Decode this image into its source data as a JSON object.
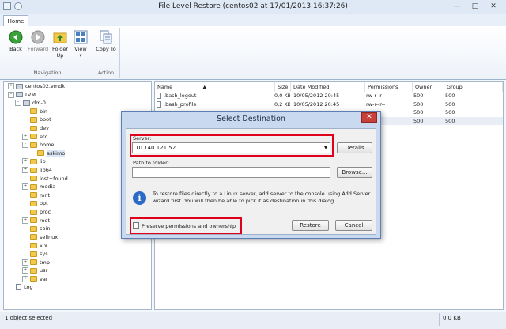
{
  "window": {
    "title": "File Level Restore (centos02 at 17/01/2013 16:37:26)",
    "controls": {
      "minimize": "—",
      "maximize": "□",
      "close": "✕"
    }
  },
  "ribbon": {
    "tabs": [
      {
        "label": "Home",
        "active": true
      }
    ],
    "buttons": [
      {
        "label": "Back",
        "icon": "back-arrow-icon"
      },
      {
        "label": "Forward",
        "icon": "forward-arrow-icon"
      },
      {
        "label": "Folder Up",
        "icon": "folder-up-icon"
      },
      {
        "label": "View",
        "icon": "view-grid-icon"
      },
      {
        "label": "Copy To",
        "icon": "copy-to-icon"
      }
    ],
    "groups": [
      {
        "label": "Navigation"
      },
      {
        "label": "Action"
      }
    ]
  },
  "tree": {
    "nodes": [
      {
        "label": "centos02.vmdk",
        "icon": "disk-icon",
        "expander": "+"
      },
      {
        "label": "LVM",
        "icon": "disk-icon",
        "expander": "-"
      },
      {
        "label": "dm-0",
        "icon": "disk-icon",
        "expander": "-"
      },
      {
        "label": "bin",
        "icon": "folder-icon",
        "expander": ""
      },
      {
        "label": "boot",
        "icon": "folder-icon",
        "expander": ""
      },
      {
        "label": "dev",
        "icon": "folder-icon",
        "expander": ""
      },
      {
        "label": "etc",
        "icon": "folder-icon",
        "expander": "+"
      },
      {
        "label": "home",
        "icon": "folder-icon",
        "expander": "-"
      },
      {
        "label": "askimo",
        "icon": "folder-icon",
        "expander": ""
      },
      {
        "label": "lib",
        "icon": "folder-icon",
        "expander": "+"
      },
      {
        "label": "lib64",
        "icon": "folder-icon",
        "expander": "+"
      },
      {
        "label": "lost+found",
        "icon": "folder-icon",
        "expander": ""
      },
      {
        "label": "media",
        "icon": "folder-icon",
        "expander": "+"
      },
      {
        "label": "mnt",
        "icon": "folder-icon",
        "expander": ""
      },
      {
        "label": "opt",
        "icon": "folder-icon",
        "expander": ""
      },
      {
        "label": "proc",
        "icon": "folder-icon",
        "expander": ""
      },
      {
        "label": "root",
        "icon": "folder-icon",
        "expander": "+"
      },
      {
        "label": "sbin",
        "icon": "folder-icon",
        "expander": ""
      },
      {
        "label": "selinux",
        "icon": "folder-icon",
        "expander": ""
      },
      {
        "label": "srv",
        "icon": "folder-icon",
        "expander": ""
      },
      {
        "label": "sys",
        "icon": "folder-icon",
        "expander": ""
      },
      {
        "label": "tmp",
        "icon": "folder-icon",
        "expander": "+"
      },
      {
        "label": "usr",
        "icon": "folder-icon",
        "expander": "+"
      },
      {
        "label": "var",
        "icon": "folder-icon",
        "expander": "+"
      },
      {
        "label": "Log",
        "icon": "log-icon",
        "expander": ""
      }
    ]
  },
  "list": {
    "columns": [
      "Name",
      "Size",
      "Date Modified",
      "Permissions",
      "Owner",
      "Group"
    ],
    "rows": [
      {
        "name": ".bash_logout",
        "size": "0,0 KB",
        "date": "10/05/2012 20:45",
        "perm": "rw-r--r--",
        "owner": "500",
        "group": "500"
      },
      {
        "name": ".bash_profile",
        "size": "0,2 KB",
        "date": "10/05/2012 20:45",
        "perm": "rw-r--r--",
        "owner": "500",
        "group": "500"
      },
      {
        "name": "",
        "size": "",
        "date": "",
        "perm": "",
        "owner": "500",
        "group": "500"
      },
      {
        "name": "",
        "size": "",
        "date": "",
        "perm": "w-",
        "owner": "500",
        "group": "500"
      }
    ]
  },
  "dialog": {
    "title": "Select Destination",
    "server_label": "Server:",
    "server_value": "10.140.121.52",
    "details_button": "Details",
    "path_label": "Path to folder:",
    "path_value": "",
    "browse_button": "Browse...",
    "info_text": "To restore files directly to a Linux server, add server to the console using Add Server wizard first. You will then be able to pick it as destination in this dialog.",
    "preserve_label": "Preserve permissions and ownership",
    "preserve_checked": false,
    "restore_button": "Restore",
    "cancel_button": "Cancel"
  },
  "status": {
    "left": "1 object selected",
    "right": "0,0 KB"
  }
}
